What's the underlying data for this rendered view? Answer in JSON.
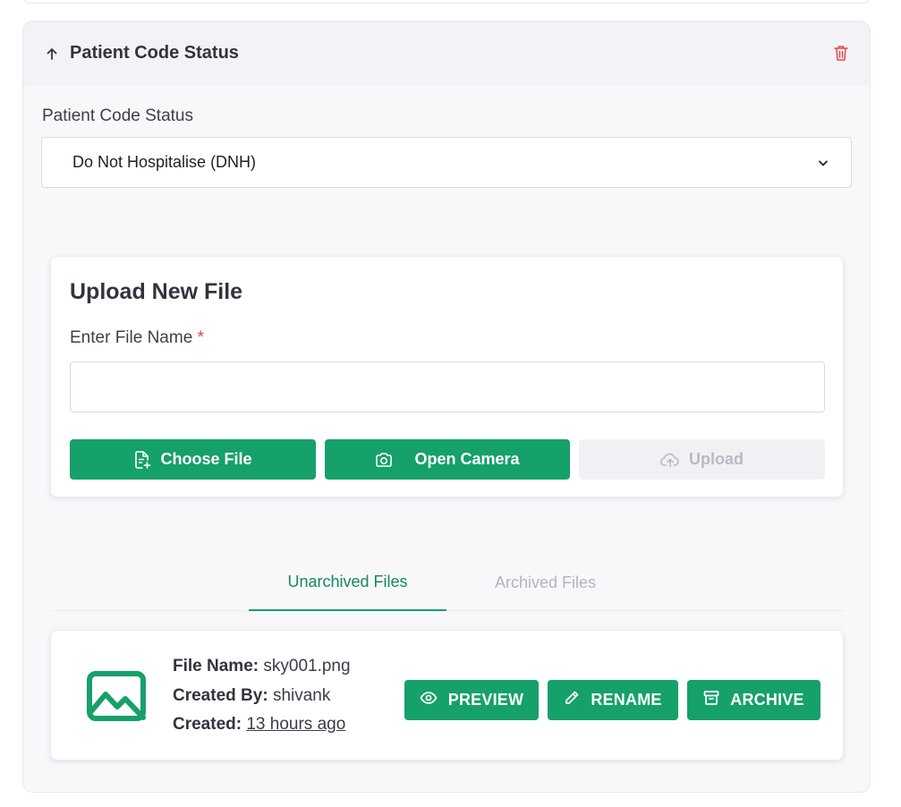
{
  "section": {
    "title": "Patient Code Status",
    "field_label": "Patient Code Status",
    "selected_value": "Do Not Hospitalise (DNH)"
  },
  "upload": {
    "title": "Upload New File",
    "file_name_label": "Enter File Name",
    "required_mark": "*",
    "file_name_value": "",
    "choose_file_label": "Choose File",
    "open_camera_label": "Open Camera",
    "upload_label": "Upload"
  },
  "tabs": [
    {
      "label": "Unarchived Files",
      "active": true
    },
    {
      "label": "Archived Files",
      "active": false
    }
  ],
  "files": [
    {
      "name_key": "File Name:",
      "name": "sky001.png",
      "created_by_key": "Created By:",
      "created_by": "shivank",
      "created_key": "Created:",
      "created": "13 hours ago",
      "actions": {
        "preview": "PREVIEW",
        "rename": "RENAME",
        "archive": "ARCHIVE"
      }
    }
  ],
  "icons": {
    "collapse": "arrow-up-icon",
    "delete": "trash-icon",
    "dropdown": "chevron-down-icon",
    "choose_file": "file-plus-icon",
    "camera": "camera-icon",
    "upload": "cloud-upload-icon",
    "thumbnail": "image-icon",
    "preview": "eye-icon",
    "rename": "pencil-icon",
    "archive": "archive-box-icon"
  },
  "colors": {
    "accent": "#16a06a",
    "danger": "#e5484d",
    "section_bg": "#f8f8fb",
    "header_bg": "#f2f2f7"
  }
}
